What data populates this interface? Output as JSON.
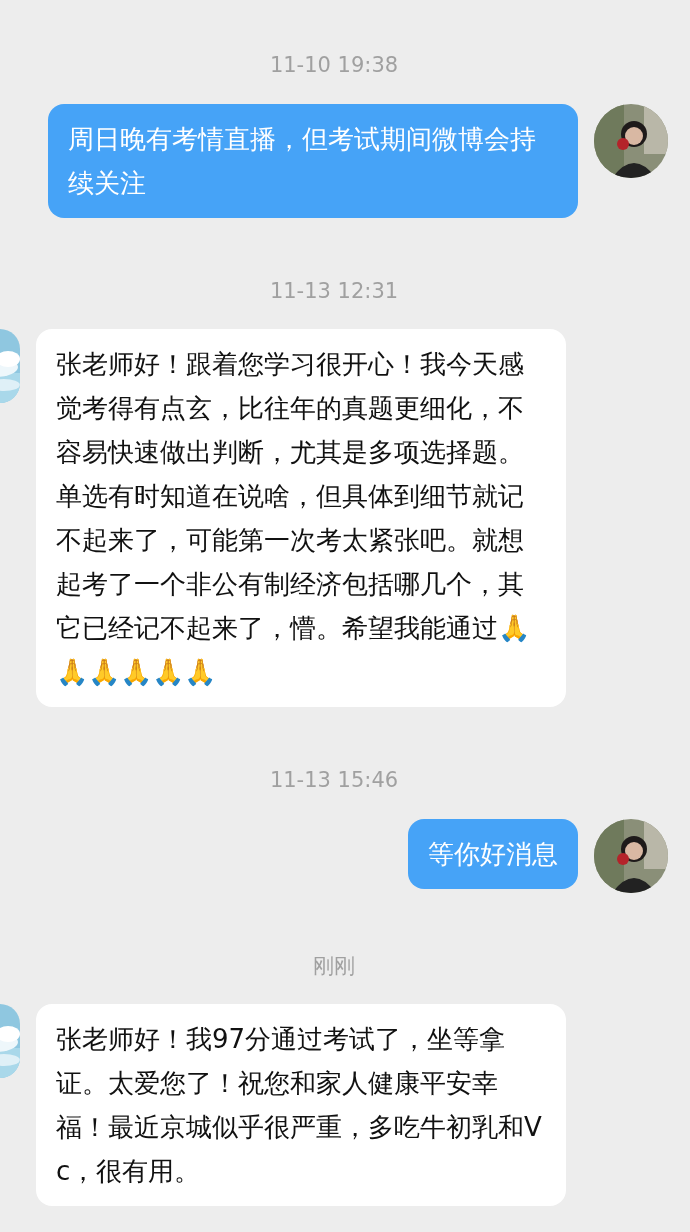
{
  "messages": [
    {
      "kind": "time",
      "text": "11-10 19:38"
    },
    {
      "kind": "message",
      "outgoing": true,
      "text": "周日晚有考情直播，但考试期间微博会持续关注"
    },
    {
      "kind": "time",
      "text": "11-13 12:31"
    },
    {
      "kind": "message",
      "outgoing": false,
      "text": "张老师好！跟着您学习很开心！我今天感觉考得有点玄，比往年的真题更细化，不容易快速做出判断，尤其是多项选择题。单选有时知道在说啥，但具体到细节就记不起来了，可能第一次考太紧张吧。就想起考了一个非公有制经济包括哪几个，其它已经记不起来了，懵。希望我能通过🙏🙏🙏🙏🙏🙏"
    },
    {
      "kind": "time",
      "text": "11-13 15:46"
    },
    {
      "kind": "message",
      "outgoing": true,
      "text": "等你好消息"
    },
    {
      "kind": "time",
      "text": "刚刚"
    },
    {
      "kind": "message",
      "outgoing": false,
      "text": "张老师好！我97分通过考试了，坐等拿证。太爱您了！祝您和家人健康平安幸福！最近京城似乎很严重，多吃牛初乳和Vc，很有用。"
    }
  ]
}
